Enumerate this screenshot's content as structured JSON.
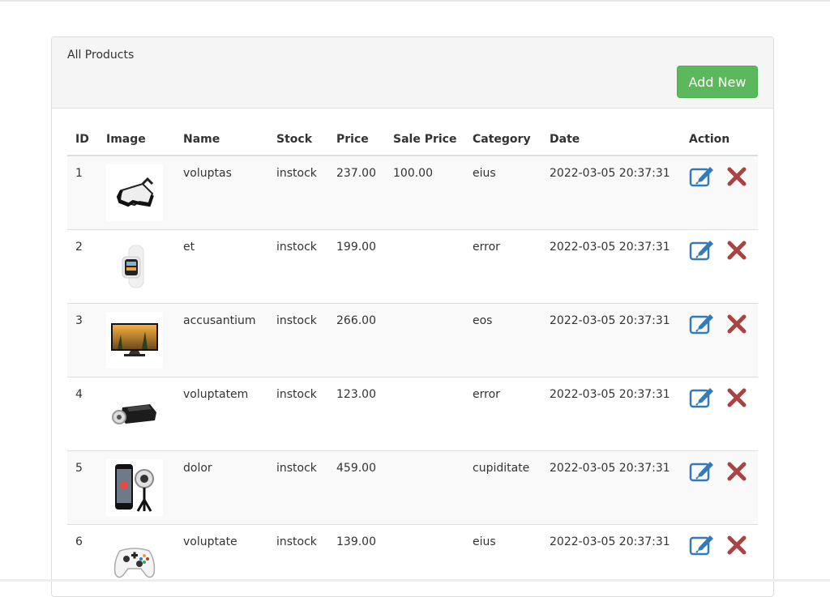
{
  "panel": {
    "title": "All Products",
    "add_button": "Add New"
  },
  "table": {
    "headers": {
      "id": "ID",
      "image": "Image",
      "name": "Name",
      "stock": "Stock",
      "price": "Price",
      "sale_price": "Sale Price",
      "category": "Category",
      "date": "Date",
      "action": "Action"
    },
    "rows": [
      {
        "id": "1",
        "image_icon": "vr-headset-icon",
        "name": "voluptas",
        "stock": "instock",
        "price": "237.00",
        "sale_price": "100.00",
        "category": "eius",
        "date": "2022-03-05 20:37:31"
      },
      {
        "id": "2",
        "image_icon": "smartwatch-icon",
        "name": "et",
        "stock": "instock",
        "price": "199.00",
        "sale_price": "",
        "category": "error",
        "date": "2022-03-05 20:37:31"
      },
      {
        "id": "3",
        "image_icon": "tv-icon",
        "name": "accusantium",
        "stock": "instock",
        "price": "266.00",
        "sale_price": "",
        "category": "eos",
        "date": "2022-03-05 20:37:31"
      },
      {
        "id": "4",
        "image_icon": "vr-headset-dark-icon",
        "name": "voluptatem",
        "stock": "instock",
        "price": "123.00",
        "sale_price": "",
        "category": "error",
        "date": "2022-03-05 20:37:31"
      },
      {
        "id": "5",
        "image_icon": "phone-camera-icon",
        "name": "dolor",
        "stock": "instock",
        "price": "459.00",
        "sale_price": "",
        "category": "cupiditate",
        "date": "2022-03-05 20:37:31"
      },
      {
        "id": "6",
        "image_icon": "game-controller-icon",
        "name": "voluptate",
        "stock": "instock",
        "price": "139.00",
        "sale_price": "",
        "category": "eius",
        "date": "2022-03-05 20:37:31"
      }
    ]
  },
  "colors": {
    "accent": "#5cb85c",
    "edit": "#337ab7",
    "delete": "#a94442"
  }
}
